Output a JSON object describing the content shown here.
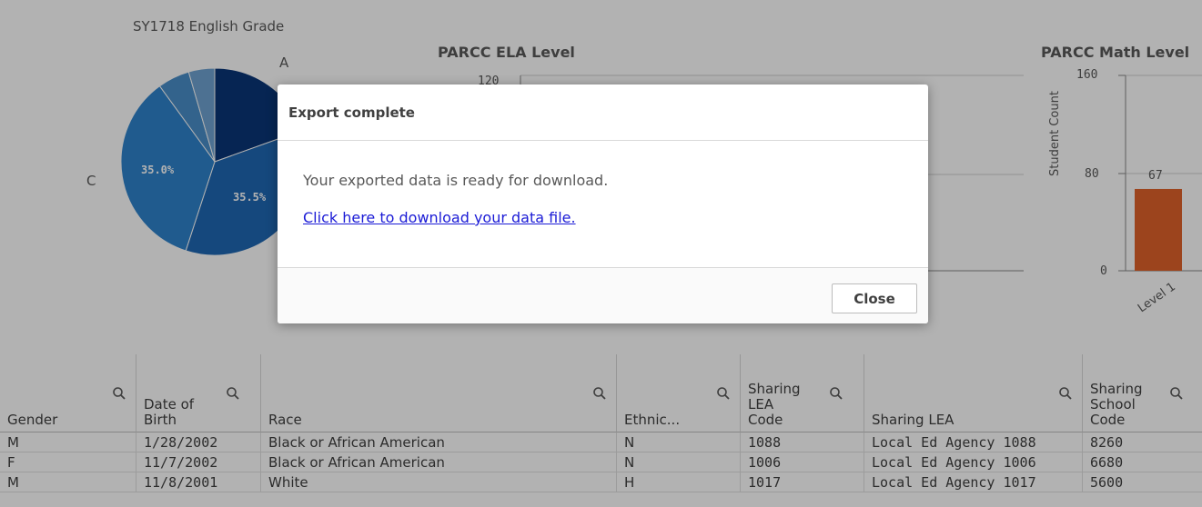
{
  "charts": {
    "pie": {
      "title": "SY1718 English Grade",
      "label_a": "A",
      "label_c": "C",
      "pct_1": "35.0%",
      "pct_2": "35.5%"
    },
    "ela": {
      "title": "PARCC ELA Level",
      "tick_partial": "120"
    },
    "math": {
      "title": "PARCC Math Level",
      "ylabel": "Student Count",
      "ticks": [
        "160",
        "80",
        "0"
      ],
      "bar_label": "67",
      "x_label": "Level 1"
    }
  },
  "chart_data": [
    {
      "type": "pie",
      "title": "SY1718 English Grade",
      "slices": [
        {
          "label": "A",
          "value": 0.195
        },
        {
          "label": "",
          "value": 0.355
        },
        {
          "label": "C",
          "value": 0.35
        },
        {
          "label": "",
          "value": 0.055
        },
        {
          "label": "",
          "value": 0.045
        }
      ],
      "colors": [
        "#0a3578",
        "#1f68b3",
        "#2f83cc",
        "#4a8fc9",
        "#6fa3d1"
      ]
    },
    {
      "type": "bar",
      "title": "PARCC Math Level",
      "ylabel": "Student Count",
      "categories": [
        "Level 1"
      ],
      "values": [
        67
      ],
      "ylim": [
        0,
        160
      ],
      "color": "#e0622a"
    }
  ],
  "dialog": {
    "title": "Export complete",
    "message": "Your exported data is ready for download.",
    "link": "Click here to download your data file.",
    "close": "Close"
  },
  "table": {
    "columns": [
      "Gender",
      "Date of\nBirth",
      "Race",
      "Ethnic...",
      "Sharing\nLEA\nCode",
      "Sharing LEA",
      "Sharing\nSchool\nCode"
    ],
    "rows": [
      [
        "M",
        "1/28/2002",
        "Black or African American",
        "N",
        "1088",
        "Local Ed Agency 1088",
        "8260"
      ],
      [
        "F",
        "11/7/2002",
        "Black or African American",
        "N",
        "1006",
        "Local Ed Agency 1006",
        "6680"
      ],
      [
        "M",
        "11/8/2001",
        "White",
        "H",
        "1017",
        "Local Ed Agency 1017",
        "5600"
      ]
    ]
  }
}
